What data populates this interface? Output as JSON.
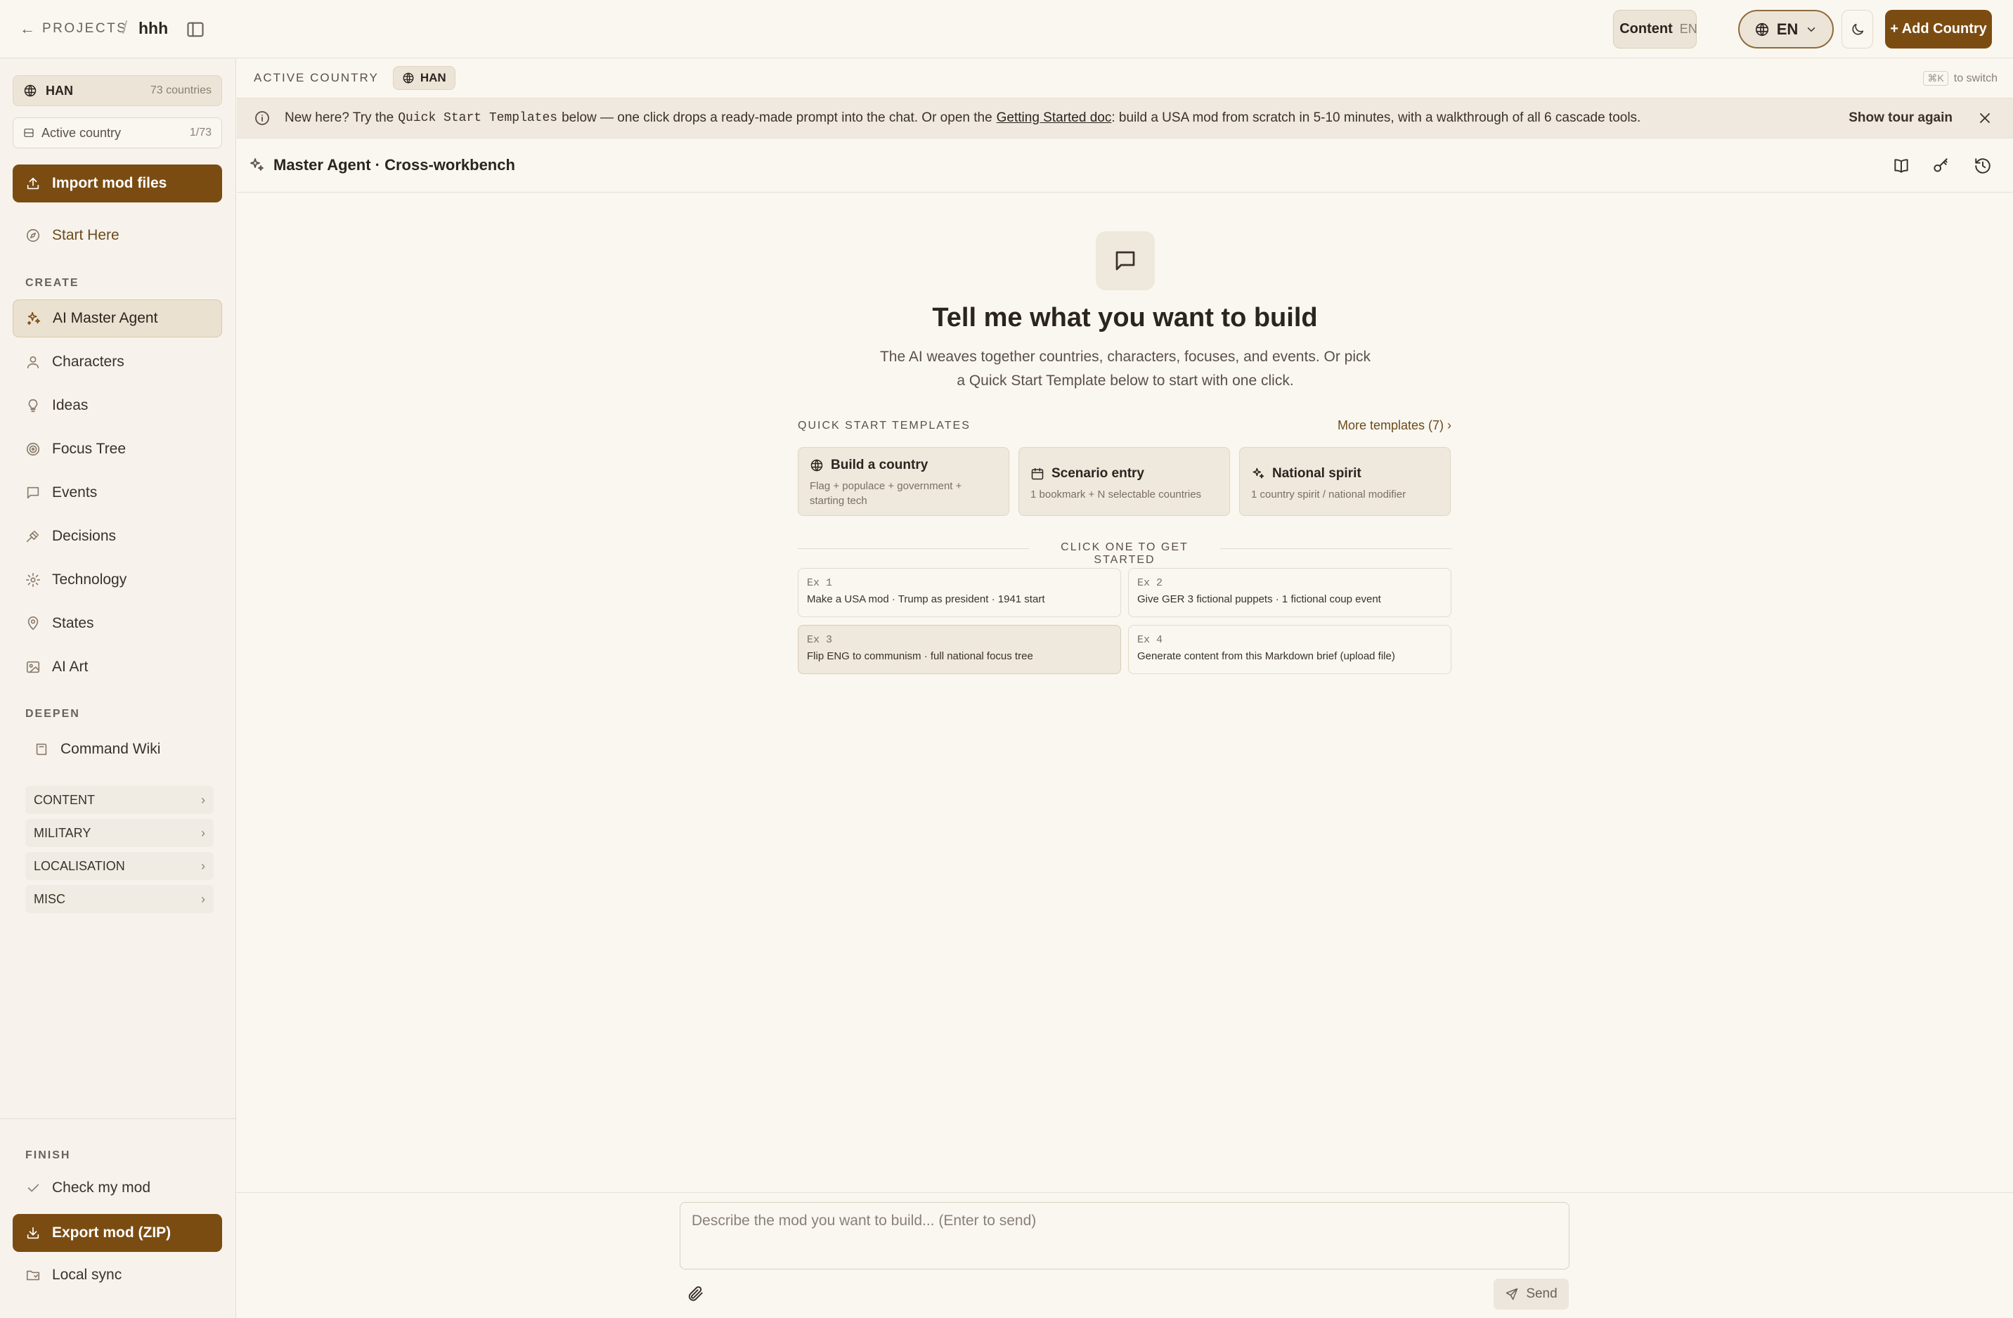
{
  "topbar": {
    "back_label": "PROJECTS",
    "separator": "/",
    "project_name": "hhh",
    "content_toggle": {
      "label": "Content",
      "lang": "EN"
    },
    "language": "EN",
    "add_country": "+ Add Country"
  },
  "sidebar": {
    "country": {
      "code": "HAN",
      "count": "73 countries"
    },
    "active_country": {
      "label": "Active country",
      "count": "1/73"
    },
    "import_label": "Import mod files",
    "start_here": "Start Here",
    "create_label": "CREATE",
    "create_items": [
      {
        "label": "AI Master Agent",
        "icon": "sparkles-icon"
      },
      {
        "label": "Characters",
        "icon": "person-icon"
      },
      {
        "label": "Ideas",
        "icon": "lightbulb-icon"
      },
      {
        "label": "Focus Tree",
        "icon": "target-icon"
      },
      {
        "label": "Events",
        "icon": "message-icon"
      },
      {
        "label": "Decisions",
        "icon": "gavel-icon"
      },
      {
        "label": "Technology",
        "icon": "gear-icon"
      },
      {
        "label": "States",
        "icon": "pin-icon"
      },
      {
        "label": "AI Art",
        "icon": "image-icon"
      }
    ],
    "deepen_label": "DEEPEN",
    "command_wiki": "Command Wiki",
    "groups": [
      "CONTENT",
      "MILITARY",
      "LOCALISATION",
      "MISC"
    ],
    "finish_label": "FINISH",
    "check_mod": "Check my mod",
    "export_label": "Export mod (ZIP)",
    "local_sync": "Local sync"
  },
  "country_bar": {
    "label": "ACTIVE COUNTRY",
    "country": "HAN",
    "shortcut": "⌘K",
    "hint": "to switch"
  },
  "banner": {
    "prefix": "New here? Try the",
    "code": "Quick Start Templates",
    "middle": "below — one click drops a ready-made prompt into the chat. Or open the",
    "link": "Getting Started doc",
    "suffix": ": build a USA mod from scratch in 5-10 minutes, with a walkthrough of all 6 cascade tools.",
    "tour": "Show tour again"
  },
  "agent": {
    "title": "Master Agent · Cross-workbench"
  },
  "hero": {
    "title": "Tell me what you want to build",
    "subtitle": "The AI weaves together countries, characters, focuses, and events. Or pick a Quick Start Template below to start with one click."
  },
  "templates": {
    "label": "QUICK START TEMPLATES",
    "more": "More templates (7) ›",
    "items": [
      {
        "title": "Build a country",
        "desc": "Flag + populace + government + starting tech",
        "icon": "globe-icon"
      },
      {
        "title": "Scenario entry",
        "desc": "1 bookmark + N selectable countries",
        "icon": "calendar-icon"
      },
      {
        "title": "National spirit",
        "desc": "1 country spirit / national modifier",
        "icon": "sparkles-icon"
      }
    ]
  },
  "examples": {
    "label": "CLICK ONE TO GET STARTED",
    "items": [
      {
        "tag": "Ex 1",
        "text": "Make a USA mod · Trump as president · 1941 start"
      },
      {
        "tag": "Ex 2",
        "text": "Give GER 3 fictional puppets · 1 fictional coup event"
      },
      {
        "tag": "Ex 3",
        "text": "Flip ENG to communism · full national focus tree"
      },
      {
        "tag": "Ex 4",
        "text": "Generate content from this Markdown brief (upload file)"
      }
    ]
  },
  "composer": {
    "placeholder": "Describe the mod you want to build... (Enter to send)",
    "send": "Send"
  },
  "colors": {
    "accent": "#7b4c12",
    "background": "#faf7f0",
    "sidebar_bg": "#f7f3ec",
    "card_bg": "#efe8dc"
  }
}
